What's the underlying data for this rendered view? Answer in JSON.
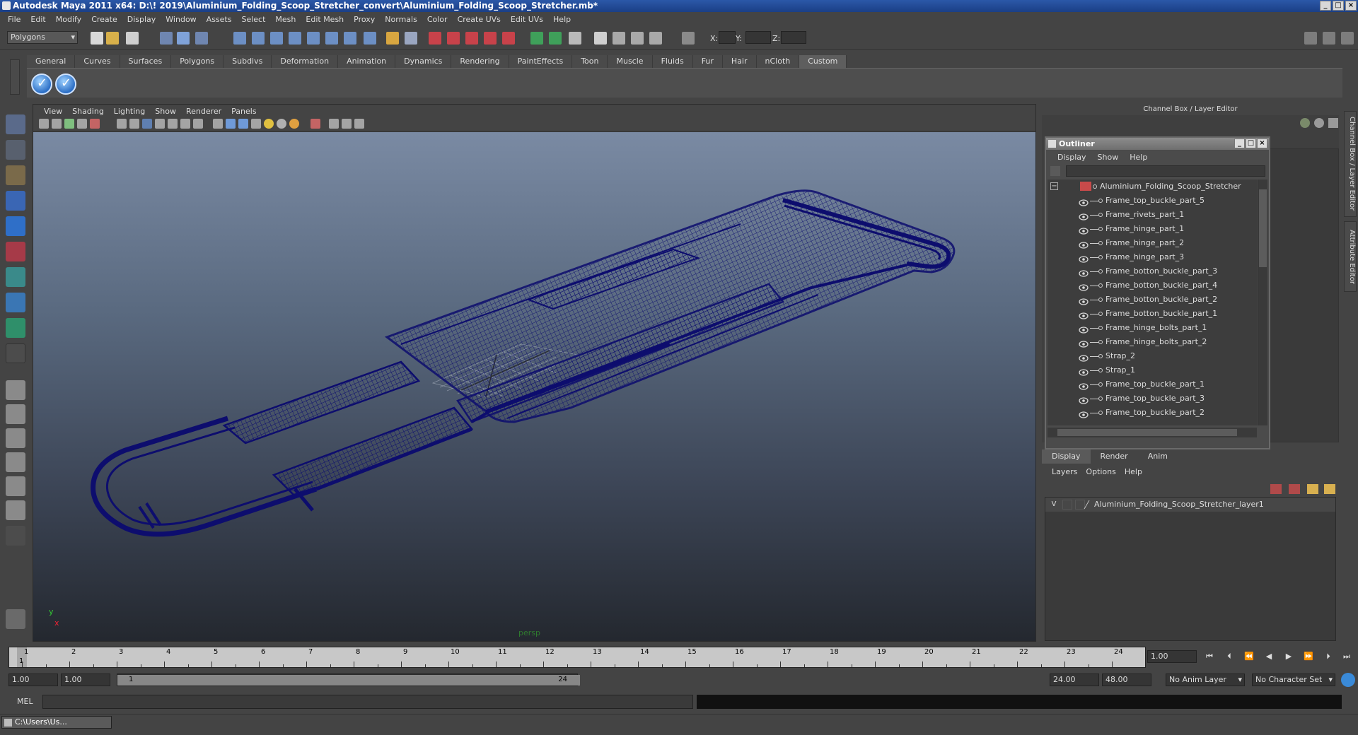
{
  "window": {
    "title": "Autodesk Maya 2011 x64: D:\\! 2019\\Aluminium_Folding_Scoop_Stretcher_convert\\Aluminium_Folding_Scoop_Stretcher.mb*",
    "minimize": "_",
    "maximize": "□",
    "close": "×"
  },
  "menubar": [
    "File",
    "Edit",
    "Modify",
    "Create",
    "Display",
    "Window",
    "Assets",
    "Select",
    "Mesh",
    "Edit Mesh",
    "Proxy",
    "Normals",
    "Color",
    "Create UVs",
    "Edit UVs",
    "Help"
  ],
  "status": {
    "mode": "Polygons",
    "x_label": "X:",
    "y_label": "Y:",
    "z_label": "Z:"
  },
  "shelf": {
    "tabs": [
      "General",
      "Curves",
      "Surfaces",
      "Polygons",
      "Subdivs",
      "Deformation",
      "Animation",
      "Dynamics",
      "Rendering",
      "PaintEffects",
      "Toon",
      "Muscle",
      "Fluids",
      "Fur",
      "Hair",
      "nCloth",
      "Custom"
    ],
    "active_tab": "Custom"
  },
  "viewport": {
    "menu": [
      "View",
      "Shading",
      "Lighting",
      "Show",
      "Renderer",
      "Panels"
    ],
    "camera": "persp",
    "axis_y": "y",
    "axis_x": "x",
    "wire_color": "#0d0d6e"
  },
  "channel_box": {
    "title": "Channel Box / Layer Editor",
    "side_tabs": [
      "Channel Box / Layer Editor",
      "Attribute Editor"
    ]
  },
  "outliner": {
    "title": "Outliner",
    "menu": [
      "Display",
      "Show",
      "Help"
    ],
    "collapse": "−",
    "root": "Aluminium_Folding_Scoop_Stretcher",
    "items": [
      "Frame_top_buckle_part_5",
      "Frame_rivets_part_1",
      "Frame_hinge_part_1",
      "Frame_hinge_part_2",
      "Frame_hinge_part_3",
      "Frame_botton_buckle_part_3",
      "Frame_botton_buckle_part_4",
      "Frame_botton_buckle_part_2",
      "Frame_botton_buckle_part_1",
      "Frame_hinge_bolts_part_1",
      "Frame_hinge_bolts_part_2",
      "Strap_2",
      "Strap_1",
      "Frame_top_buckle_part_1",
      "Frame_top_buckle_part_3",
      "Frame_top_buckle_part_2"
    ]
  },
  "layer_editor": {
    "tabs": [
      "Display",
      "Render",
      "Anim"
    ],
    "active_tab": "Display",
    "menu": [
      "Layers",
      "Options",
      "Help"
    ],
    "layer_visibility": "V",
    "layer_name": "Aluminium_Folding_Scoop_Stretcher_layer1"
  },
  "timeline": {
    "ticks": [
      "1",
      "2",
      "3",
      "4",
      "5",
      "6",
      "7",
      "8",
      "9",
      "10",
      "11",
      "12",
      "13",
      "14",
      "15",
      "16",
      "17",
      "18",
      "19",
      "20",
      "21",
      "22",
      "23",
      "24"
    ],
    "current_marker": "1",
    "current_frame": "1.00"
  },
  "range": {
    "start": "1.00",
    "playback_start": "1.00",
    "slider_start": "1",
    "slider_end": "24",
    "playback_end": "24.00",
    "end": "48.00",
    "anim_layer": "No Anim Layer",
    "character_set": "No Character Set"
  },
  "command_line": {
    "label": "MEL"
  },
  "taskbar": {
    "item": "C:\\Users\\Us..."
  }
}
